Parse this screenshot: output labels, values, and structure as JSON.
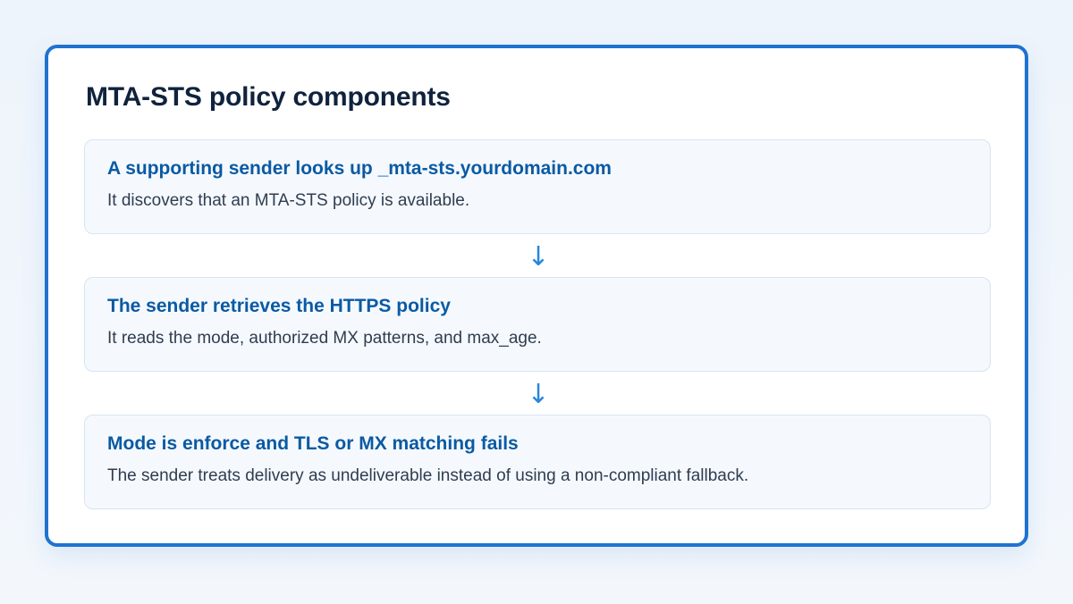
{
  "title": "MTA-STS policy components",
  "steps": [
    {
      "heading": "A supporting sender looks up _mta-sts.yourdomain.com",
      "description": "It discovers that an MTA-STS policy is available."
    },
    {
      "heading": "The sender retrieves the HTTPS policy",
      "description": "It reads the mode, authorized MX patterns, and max_age."
    },
    {
      "heading": "Mode is enforce and TLS or MX matching fails",
      "description": "The sender treats delivery as undeliverable instead of using a non-compliant fallback."
    }
  ],
  "arrow_glyph": "↓",
  "colors": {
    "accent_border": "#1f73cf",
    "heading": "#0a5aa3",
    "arrow": "#2a86de",
    "step_background": "#f5f9fe"
  }
}
